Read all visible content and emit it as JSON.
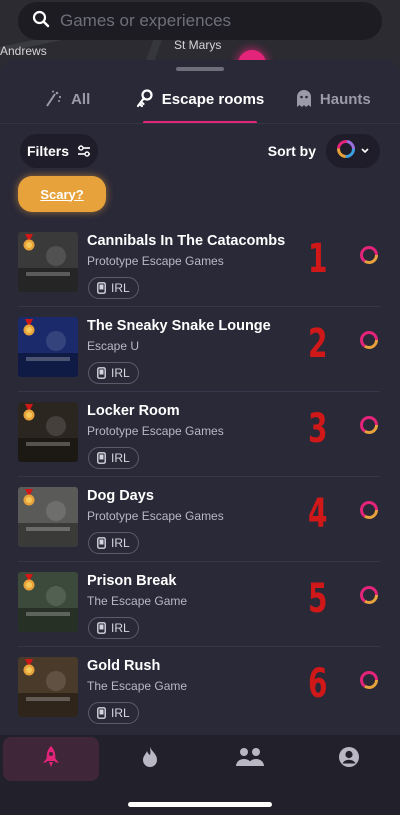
{
  "map": {
    "labels": [
      "Andrews",
      "St Marys"
    ]
  },
  "search": {
    "placeholder": "Games or experiences",
    "icon": "search-icon"
  },
  "tabs": [
    {
      "label": "All",
      "icon": "sparkle-icon",
      "active": false
    },
    {
      "label": "Escape rooms",
      "icon": "key-icon",
      "active": true
    },
    {
      "label": "Haunts",
      "icon": "ghost-icon",
      "active": false
    }
  ],
  "toolbar": {
    "filters_label": "Filters",
    "sort_label": "Sort by"
  },
  "scary_chip": "Scary?",
  "colors": {
    "accent": "#e4247a",
    "scary": "#e8a23b",
    "number": "#d01818"
  },
  "list": [
    {
      "title": "Cannibals In The Catacombs",
      "company": "Prototype Escape Games",
      "tag": "IRL",
      "rank": "1",
      "thumb_color": "#3a3a3a"
    },
    {
      "title": "The Sneaky Snake Lounge",
      "company": "Escape U",
      "tag": "IRL",
      "rank": "2",
      "thumb_color": "#1a2a6a"
    },
    {
      "title": "Locker Room",
      "company": "Prototype Escape Games",
      "tag": "IRL",
      "rank": "3",
      "thumb_color": "#2c2620"
    },
    {
      "title": "Dog Days",
      "company": "Prototype Escape Games",
      "tag": "IRL",
      "rank": "4",
      "thumb_color": "#5a5a58"
    },
    {
      "title": "Prison Break",
      "company": "The Escape Game",
      "tag": "IRL",
      "rank": "5",
      "thumb_color": "#3b4a3a"
    },
    {
      "title": "Gold Rush",
      "company": "The Escape Game",
      "tag": "IRL",
      "rank": "6",
      "thumb_color": "#4a3a2a"
    }
  ],
  "nav": [
    {
      "name": "nav-explore",
      "icon": "rocket-icon",
      "active": true
    },
    {
      "name": "nav-trending",
      "icon": "flame-icon",
      "active": false
    },
    {
      "name": "nav-friends",
      "icon": "people-icon",
      "active": false
    },
    {
      "name": "nav-profile",
      "icon": "profile-icon",
      "active": false
    }
  ]
}
